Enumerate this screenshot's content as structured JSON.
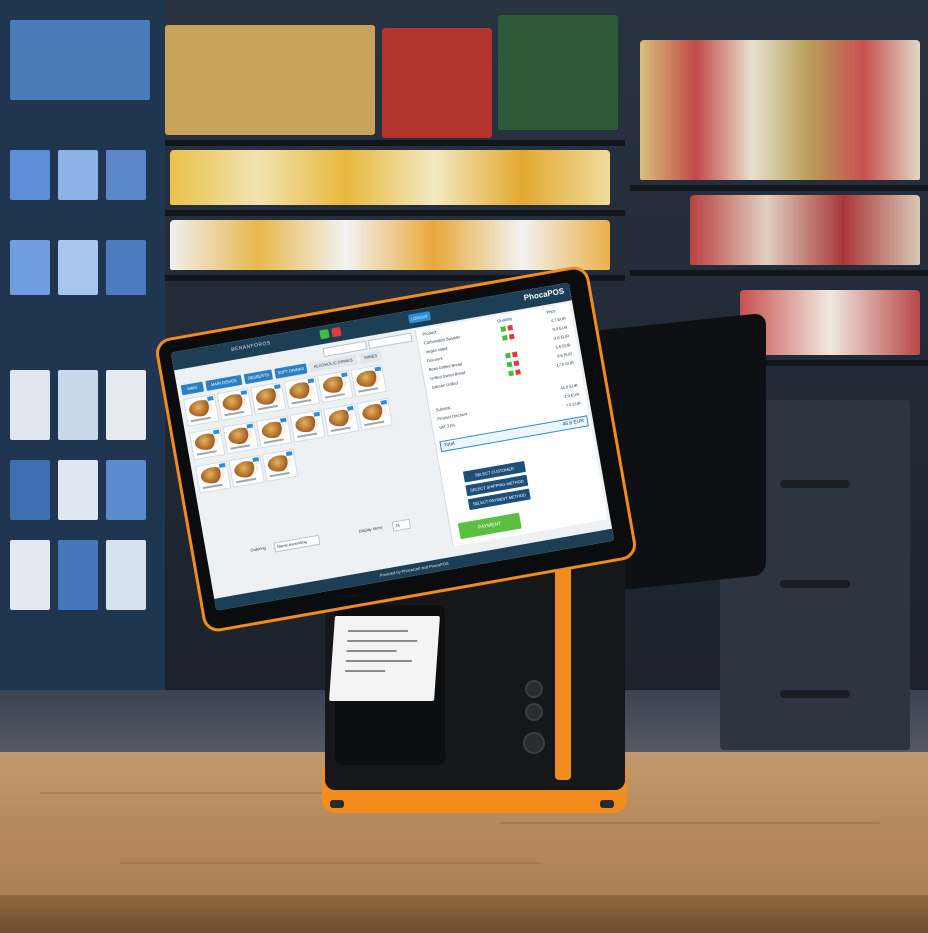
{
  "screen": {
    "brand": "PhocaPOS",
    "topbar_title": "BENANFOROS",
    "topbar_button": "LOGOUT",
    "tabs": [
      {
        "label": "MAIN"
      },
      {
        "label": "MAIN DISHES"
      },
      {
        "label": "DESSERTS"
      },
      {
        "label": "SOFT DRINKS"
      },
      {
        "label": "ALCOHOLIC DRINKS"
      },
      {
        "label": "WINES"
      }
    ],
    "order_head": {
      "product": "Product",
      "quantity": "Quantity",
      "price": "Price"
    },
    "order_items": [
      {
        "name": "Carbonated Sparkler",
        "price": "4.7 EUR"
      },
      {
        "name": "Vegan salad",
        "price": "9.9 EUR"
      },
      {
        "name": "Discount",
        "price": "-2.0 EUR"
      },
      {
        "name": "Bean Grilled Bread",
        "price": "5.6 EUR"
      },
      {
        "name": "Grilled Sweet Bread",
        "price": "6.6 EUR"
      },
      {
        "name": "Salmon Grilled",
        "price": "17.0 EUR"
      }
    ],
    "totals": [
      {
        "label": "Subtotal",
        "value": "41.8 EUR"
      },
      {
        "label": "Product Discount",
        "value": "-2.0 EUR"
      },
      {
        "label": "VAT 21%",
        "value": "7.0 EUR"
      }
    ],
    "total_label": "Total",
    "total_value": "46.8 EUR",
    "actions": [
      "SELECT CUSTOMER",
      "SELECT SHIPPING METHOD",
      "SELECT PAYMENT METHOD"
    ],
    "payment_label": "PAYMENT",
    "ordering_label": "Ordering",
    "ordering_value": "Name ascending",
    "display_label": "Display Items",
    "display_value": "24",
    "footer": "Powered by PhocaCart and PhocaPOS"
  }
}
